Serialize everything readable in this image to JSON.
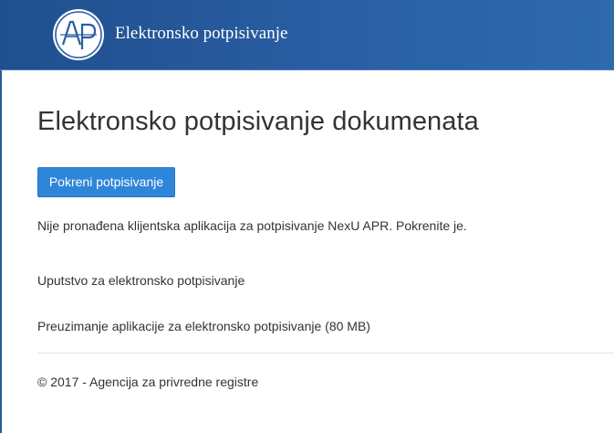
{
  "header": {
    "logo_text": "APR",
    "title": "Elektronsko potpisivanje"
  },
  "main": {
    "page_title": "Elektronsko potpisivanje dokumenata",
    "start_button_label": "Pokreni potpisivanje",
    "status_message": "Nije pronađena klijentska aplikacija za potpisivanje NexU APR. Pokrenite je.",
    "links": [
      {
        "label": "Uputstvo za elektronsko potpisivanje"
      },
      {
        "label": "Preuzimanje aplikacije za elektronsko potpisivanje (80 MB)"
      }
    ]
  },
  "footer": {
    "copyright": "© 2017 - Agencija za privredne registre"
  },
  "colors": {
    "header_blue": "#2a5ea3",
    "button_blue": "#2e86d9",
    "text": "#333333"
  }
}
